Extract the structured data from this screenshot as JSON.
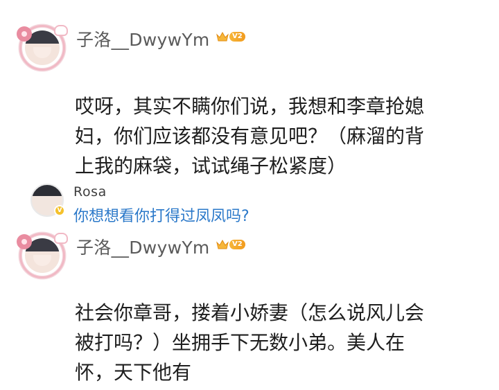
{
  "posts": [
    {
      "username": "子洛__DwywYm",
      "vip_level": "V2",
      "body_lines": [
        "哎呀，其实不瞒你们说，我想和李章抢媳",
        "妇，你们应该都没有意见吧？（麻溜的背",
        "上我的麻袋，试试绳子松紧度）"
      ]
    },
    {
      "username": "子洛__DwywYm",
      "vip_level": "V2",
      "body_lines": [
        "社会你章哥，搂着小娇妻（怎么说风儿会",
        "被打吗？）坐拥手下无数小弟。美人在",
        "怀，天下他有"
      ]
    }
  ],
  "reply": {
    "username": "Rosa",
    "badge": "V",
    "text": "你想想看你打得过凤凤吗?"
  },
  "colors": {
    "vip_badge": "#f29b1d",
    "reply_link": "#2a78c9",
    "username": "#5a5a5a"
  },
  "icons": {
    "vip": "crown-icon",
    "verified": "verified-badge-icon"
  }
}
